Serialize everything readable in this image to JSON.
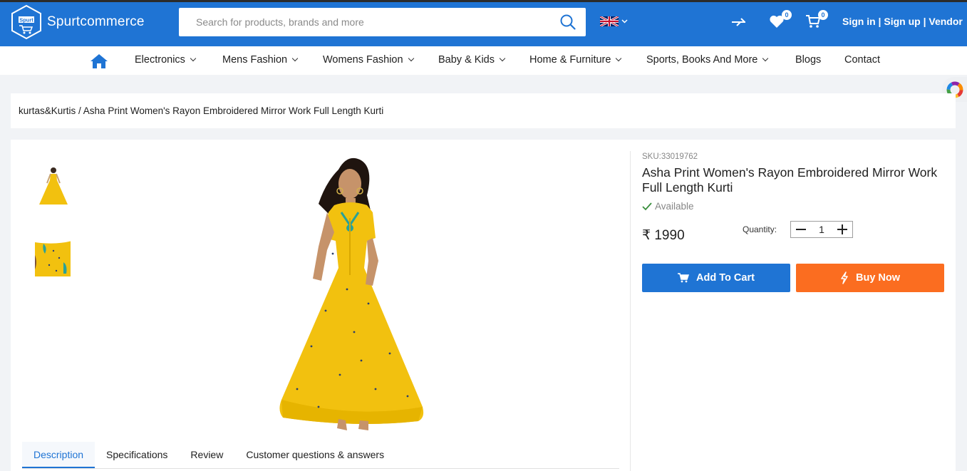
{
  "header": {
    "logo_badge": "Spurt",
    "logo_text": "Spurtcommerce",
    "search_placeholder": "Search for products, brands and more",
    "wishlist_count": "0",
    "cart_count": "0",
    "signin": "Sign in",
    "signup": "Sign up",
    "vendor": "Vendor",
    "separator": " | "
  },
  "nav": {
    "items": [
      {
        "label": "Electronics",
        "dropdown": true
      },
      {
        "label": "Mens Fashion",
        "dropdown": true
      },
      {
        "label": "Womens Fashion",
        "dropdown": true
      },
      {
        "label": "Baby & Kids",
        "dropdown": true
      },
      {
        "label": "Home & Furniture",
        "dropdown": true
      },
      {
        "label": "Sports, Books And More",
        "dropdown": true
      },
      {
        "label": "Blogs",
        "dropdown": false
      },
      {
        "label": "Contact",
        "dropdown": false
      }
    ]
  },
  "breadcrumb": {
    "category": "kurtas&Kurtis",
    "separator": " / ",
    "current": "Asha Print Women's Rayon Embroidered Mirror Work Full Length Kurti"
  },
  "product": {
    "sku": "SKU:33019762",
    "title": "Asha Print Women's Rayon Embroidered Mirror Work Full Length Kurti",
    "availability": "Available",
    "price": "₹ 1990",
    "quantity_label": "Quantity:",
    "quantity": "1",
    "add_to_cart": "Add To Cart",
    "buy_now": "Buy Now"
  },
  "tabs": [
    {
      "label": "Description",
      "active": true
    },
    {
      "label": "Specifications",
      "active": false
    },
    {
      "label": "Review",
      "active": false
    },
    {
      "label": "Customer questions & answers",
      "active": false
    }
  ],
  "colors": {
    "brand_blue": "#1f74d4",
    "buy_orange": "#fb6d20",
    "available_green": "#388e3c",
    "kurti_yellow": "#f2c10f"
  }
}
